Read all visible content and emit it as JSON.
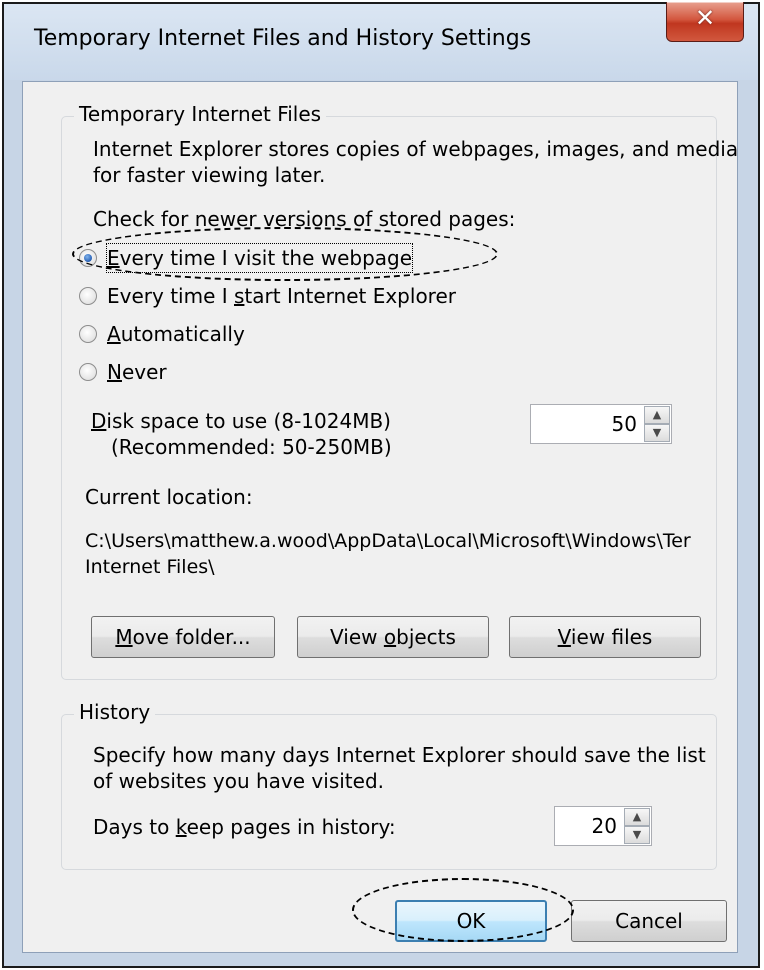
{
  "window": {
    "title": "Temporary Internet Files and History Settings",
    "close_icon": "close-icon"
  },
  "temporary_internet_files": {
    "group_title": "Temporary Internet Files",
    "description_line1": "Internet Explorer stores copies of webpages, images, and media",
    "description_line2": "for faster viewing later.",
    "check_label": "Check for newer versions of stored pages:",
    "radio_options": [
      {
        "label_pre": "",
        "label_key": "E",
        "label_post": "very time I visit the webpage",
        "checked": true
      },
      {
        "label_pre": "Every time I ",
        "label_key": "s",
        "label_post": "tart Internet Explorer",
        "checked": false
      },
      {
        "label_pre": "",
        "label_key": "A",
        "label_post": "utomatically",
        "checked": false
      },
      {
        "label_pre": "",
        "label_key": "N",
        "label_post": "ever",
        "checked": false
      }
    ],
    "disk_space_key": "D",
    "disk_space_label": "isk space to use (8-1024MB)",
    "disk_space_recommended": "(Recommended: 50-250MB)",
    "disk_space_value": "50",
    "current_location_label": "Current location:",
    "current_location_line1": "C:\\Users\\matthew.a.wood\\AppData\\Local\\Microsoft\\Windows\\Ter",
    "current_location_line2": "Internet Files\\",
    "buttons": {
      "move_folder_key": "M",
      "move_folder_rest": "ove folder...",
      "view_objects_pre": "View ",
      "view_objects_key": "o",
      "view_objects_post": "bjects",
      "view_files_key": "V",
      "view_files_rest": "iew files"
    }
  },
  "history": {
    "group_title": "History",
    "description_line1": "Specify how many days Internet Explorer should save the list",
    "description_line2": "of websites you have visited.",
    "days_label_pre": "Days to ",
    "days_label_key": "k",
    "days_label_post": "eep pages in history:",
    "days_value": "20"
  },
  "footer": {
    "ok_label": "OK",
    "cancel_label": "Cancel"
  }
}
